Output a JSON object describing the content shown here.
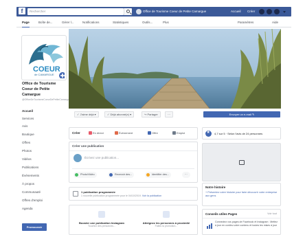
{
  "topbar": {
    "logo": "f",
    "search_placeholder": "Rechercher",
    "page_name": "Office de Tourisme Coeur de Petite Camargue",
    "links": [
      "Accueil",
      "Créer"
    ],
    "icons": [
      "search-icon",
      "friends-icon",
      "messages-icon",
      "notifications-icon",
      "help-icon",
      "caret-down-icon"
    ],
    "bar_color": "#3b5998"
  },
  "tabs": [
    "Page",
    "Boîte de...",
    "Gérer l...",
    "Notifications",
    "Statistiques",
    "Outils...",
    "Plus",
    "Paramètres",
    "Aide"
  ],
  "page": {
    "title": "Office de Tourisme Coeur de Petite Camargue",
    "handle": "@OfficeDeTourismeCoeurDePetiteCamargue",
    "logo_text": "COEUR",
    "logo_sub": "de CAMARGUE"
  },
  "nav": [
    "Accueil",
    "Services",
    "Avis",
    "Boutique",
    "Offres",
    "Photos",
    "Vidéos",
    "Publications",
    "Événements",
    "À propos",
    "Communauté",
    "Offres d'emploi",
    "Agenda"
  ],
  "promote_label": "Promouvoir",
  "actions": {
    "liked": "✓ J'aime déjà ▾",
    "following": "✓ Déjà abonné(e) ▾",
    "share": "↪ Partager",
    "more": "···",
    "email": "Envoyer un e-mail ✎"
  },
  "create": {
    "label": "Créer",
    "items": [
      "En direct",
      "Événement",
      "Offre",
      "Emploi"
    ]
  },
  "publish": {
    "header": "Créer une publication",
    "placeholder": "Écrivez une publication...",
    "pills": [
      "Photo/Vidéo",
      "Recevoir des...",
      "Identifier des..."
    ],
    "more": "···"
  },
  "scheduled": {
    "title": "1 publication programmée",
    "text": "1 nouvelle publication programmée pour le 04/10/2019.",
    "link": "Voir la publication"
  },
  "tips": [
    {
      "title": "Booster une publication Instagram",
      "sub": "Touchez des personnes..."
    },
    {
      "title": "Atteignez les personnes à proximité",
      "sub": "Faites la promotion..."
    }
  ],
  "rating": {
    "value": "4,7 sur 5",
    "text": "4,7 sur 5 · Selon l'avis de 24 personnes"
  },
  "story": {
    "title": "Notre histoire",
    "text": "+ Présentez votre histoire pour faire découvrir votre entreprise aux gens"
  },
  "pages": {
    "title": "Conseils utiles Pages",
    "all": "Voir tout",
    "text": "Connectez vos pages de Facebook et Instagram : Mettez à jour en continu votre contenu et toutes les mises à jour"
  },
  "colors": {
    "accent": "#4267b2",
    "fb_blue": "#3b5998",
    "text": "#1c1e21",
    "muted": "#90949c"
  }
}
